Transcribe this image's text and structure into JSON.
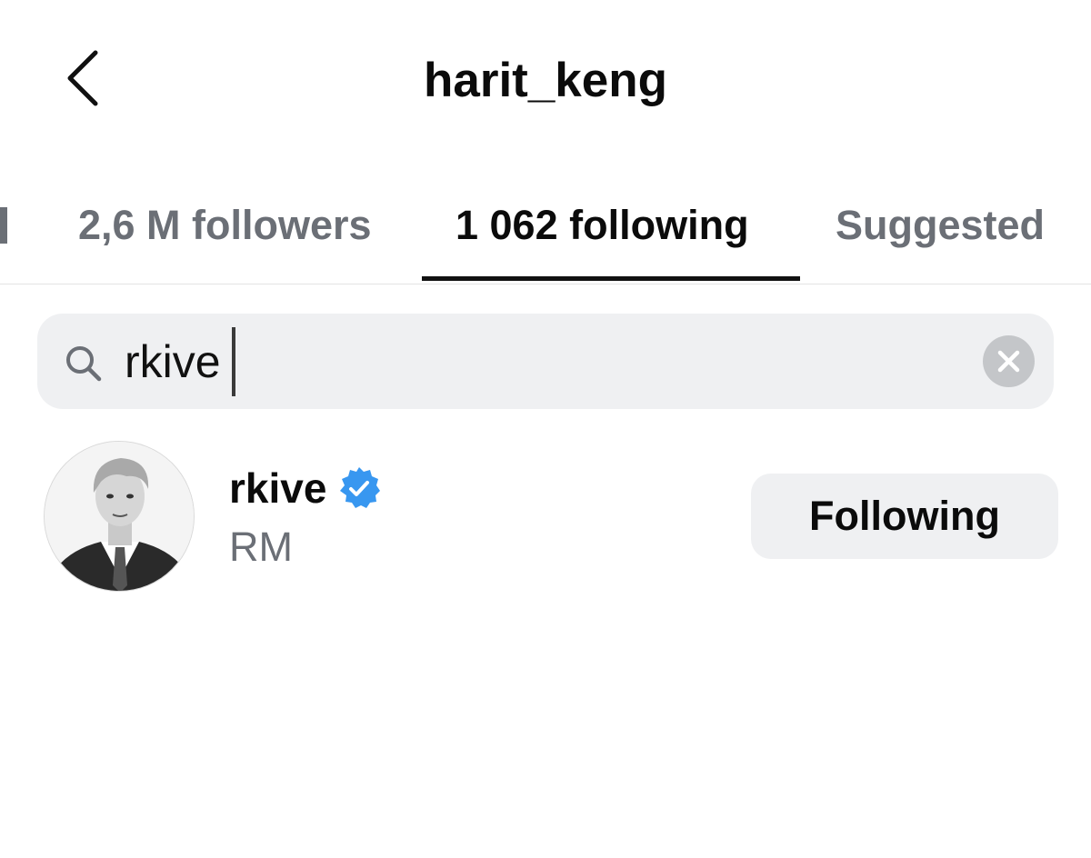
{
  "header": {
    "title": "harit_keng",
    "back_icon": "chevron-left-icon"
  },
  "tabs": [
    {
      "label": "2,6 M followers",
      "active": false
    },
    {
      "label": "1 062 following",
      "active": true
    },
    {
      "label": "Suggested",
      "active": false
    }
  ],
  "search": {
    "value": "rkive",
    "icon": "search-icon",
    "clear_icon": "clear-icon"
  },
  "results": [
    {
      "username": "rkive",
      "verified": true,
      "full_name": "RM",
      "button_label": "Following",
      "avatar_icon": "avatar"
    }
  ],
  "colors": {
    "text_primary": "#0b0b0b",
    "text_secondary": "#6b6f76",
    "field_background": "#eff0f2",
    "verified_blue": "#3897f0",
    "clear_button": "#c4c6c9"
  }
}
